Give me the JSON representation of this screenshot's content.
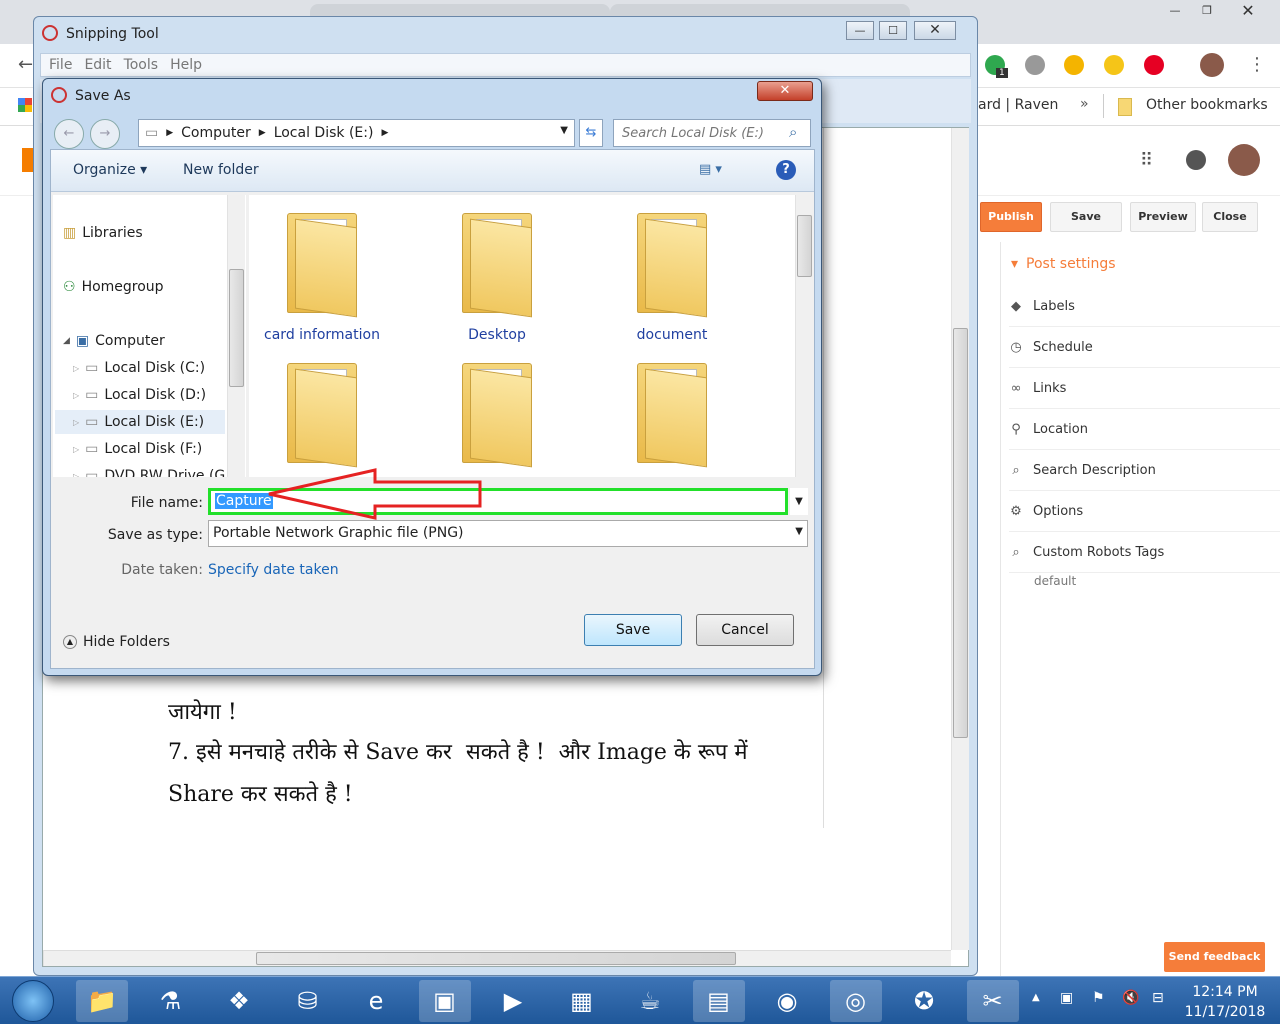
{
  "browser": {
    "bookmarks": {
      "partial_item": "ard | Raven",
      "overflow": "»",
      "other": "Other bookmarks"
    },
    "extension_badge": "1"
  },
  "blogger": {
    "buttons": {
      "publish": "Publish",
      "save": "Save",
      "preview": "Preview",
      "close": "Close"
    },
    "post_settings": {
      "title": "Post settings",
      "items": [
        {
          "label": "Labels",
          "icon": "label-icon"
        },
        {
          "label": "Schedule",
          "icon": "clock-icon"
        },
        {
          "label": "Links",
          "icon": "link-icon"
        },
        {
          "label": "Location",
          "icon": "location-pin-icon"
        },
        {
          "label": "Search Description",
          "icon": "search-icon"
        },
        {
          "label": "Options",
          "icon": "gear-icon"
        },
        {
          "label": "Custom Robots Tags",
          "icon": "search-icon"
        }
      ],
      "robots_value": "default"
    },
    "send_feedback": "Send feedback",
    "accent_color": "#f57d3a"
  },
  "snipping_tool": {
    "title": "Snipping Tool",
    "menu": [
      "File",
      "Edit",
      "Tools",
      "Help"
    ],
    "content": {
      "line1": "जायेगा !",
      "line2": "7. इसे मनचाहे तरीके से Save कर  सकते है !  और Image के रूप में",
      "line3": "Share कर सकते है !"
    }
  },
  "save_as": {
    "title": "Save As",
    "breadcrumb": [
      "Computer",
      "Local Disk (E:)"
    ],
    "search_placeholder": "Search Local Disk (E:)",
    "toolbar": {
      "organize": "Organize",
      "new_folder": "New folder"
    },
    "nav": {
      "libraries": "Libraries",
      "homegroup": "Homegroup",
      "computer": "Computer",
      "drives": [
        "Local Disk (C:)",
        "Local Disk (D:)",
        "Local Disk (E:)",
        "Local Disk (F:)",
        "DVD RW Drive (G"
      ],
      "selected": "Local Disk (E:)"
    },
    "files": [
      {
        "name": "card information"
      },
      {
        "name": "Desktop"
      },
      {
        "name": "document"
      },
      {
        "name": ""
      },
      {
        "name": ""
      },
      {
        "name": ""
      }
    ],
    "file_name_label": "File name:",
    "file_name_value": "Capture",
    "save_type_label": "Save as type:",
    "save_type_value": "Portable Network Graphic file (PNG)",
    "date_taken_label": "Date taken:",
    "date_taken_link": "Specify date taken",
    "hide_folders": "Hide Folders",
    "save_button": "Save",
    "cancel_button": "Cancel",
    "highlight_color": "#22e02a",
    "arrow_color": "#e52222"
  },
  "taskbar": {
    "time": "12:14 PM",
    "date": "11/17/2018"
  }
}
